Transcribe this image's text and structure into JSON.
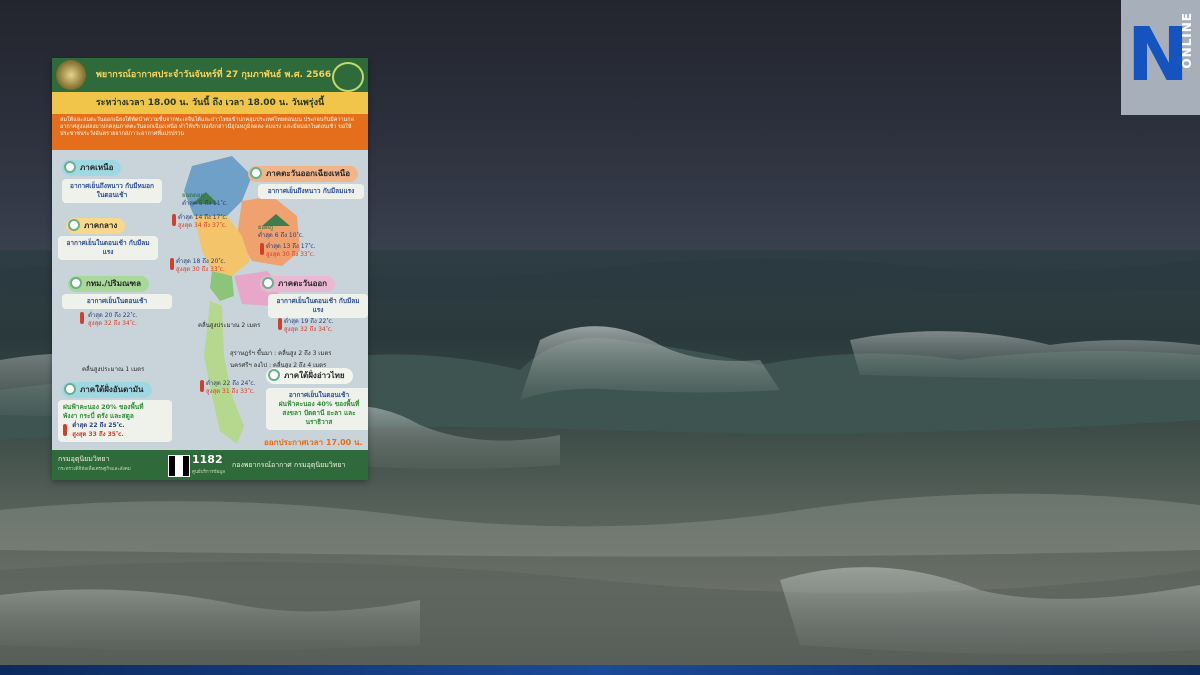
{
  "logo": {
    "mark": "N",
    "text": "ONLINE",
    "colors": {
      "background": "#a7b0ba",
      "mark": "#1553c0"
    }
  },
  "poster": {
    "title": "พยากรณ์อากาศประจำวันจันทร์ที่ 27 กุมภาพันธ์ พ.ศ. 2566",
    "subtitle": "ระหว่างเวลา 18.00 น. วันนี้ ถึง เวลา 18.00 น. วันพรุ่งนี้",
    "note": "ลมใต้และลมตะวันออกเฉียงใต้พัดนำความชื้นจากทะเลจีนใต้และอ่าวไทยเข้าปกคลุมประเทศไทยตอนบน ประกอบกับมีความกดอากาศสูงแผ่ลงมาปกคลุมภาคตะวันออกเฉียงเหนือ ทำให้บริเวณดังกล่าวมีอุณหภูมิลดลง ลมแรง และมีหมอกในตอนเช้า ขอให้ประชาชนระวังอันตรายจากสภาวะอากาศที่แปรปรวน",
    "regions": [
      {
        "name": "ภาคเหนือ",
        "desc": "อากาศเย็นถึงหนาว กับมีหมอกในตอนเช้า",
        "low": "ต่ำสุด 14 ถึง 17 ํc.",
        "high": "สูงสุด 34 ถึง 37 ํc.",
        "peak_label": "ยอดดอย",
        "peak_temp": "ต่ำสุด 5 ถึง 11 ํc."
      },
      {
        "name": "ภาคตะวันออกเฉียงเหนือ",
        "desc": "อากาศเย็นถึงหนาว กับมีลมแรง",
        "low": "ต่ำสุด 13 ถึง 17 ํc.",
        "high": "สูงสุด 30 ถึง 33 ํc.",
        "peak_label": "ยอดภู",
        "peak_temp": "ต่ำสุด 6 ถึง 10 ํc."
      },
      {
        "name": "ภาคกลาง",
        "desc": "อากาศเย็นในตอนเช้า กับมีลมแรง",
        "low": "ต่ำสุด 18 ถึง 20 ํc.",
        "high": "สูงสุด 30 ถึง 33 ํc."
      },
      {
        "name": "กทม./ปริมณฑล",
        "desc": "อากาศเย็นในตอนเช้า",
        "low": "ต่ำสุด 20 ถึง 22 ํc.",
        "high": "สูงสุด 32 ถึง 34 ํc."
      },
      {
        "name": "ภาคตะวันออก",
        "desc": "อากาศเย็นในตอนเช้า กับมีลมแรง",
        "low": "ต่ำสุด 19 ถึง 22 ํc.",
        "high": "สูงสุด 32 ถึง 34 ํc."
      },
      {
        "name": "ภาคใต้ฝั่งอันดามัน",
        "desc": "ฝนฟ้าคะนอง 20% ของพื้นที่",
        "desc2": "พังงา กระบี่ ตรัง และสตูล",
        "low": "ต่ำสุด 22 ถึง 25 ํc.",
        "high": "สูงสุด 33 ถึง 35 ํc."
      },
      {
        "name": "ภาคใต้ฝั่งอ่าวไทย",
        "desc": "อากาศเย็นในตอนเช้า",
        "desc2": "ฝนฟ้าคะนอง 40% ของพื้นที่",
        "desc3": "สงขลา ปัตตานี ยะลา และนราธิวาส",
        "low": "ต่ำสุด 22 ถึง 24 ํc.",
        "high": "สูงสุด 31 ถึง 33 ํc."
      }
    ],
    "waves": {
      "upper_gulf": "คลื่นสูงประมาณ 2 เมตร",
      "andaman": "คลื่นสูงประมาณ 1 เมตร",
      "south_gulf": "สุราษฎร์ฯ ขึ้นมา : คลื่นสูง 2 ถึง 3 เมตร",
      "south_gulf2": "นครศรีฯ ลงไป : คลื่นสูง 2 ถึง 4 เมตร"
    },
    "issued": "ออกประกาศเวลา 17.00 น.",
    "footer": {
      "dept": "กรมอุตุนิยมวิทยา",
      "dept_sub": "กระทรวงดิจิทัลเพื่อเศรษฐกิจและสังคม",
      "hotline": "1182",
      "hotline_sub": "ศูนย์บริการข้อมูล",
      "right": "กองพยากรณ์อากาศ กรมอุตุนิยมวิทยา"
    }
  }
}
